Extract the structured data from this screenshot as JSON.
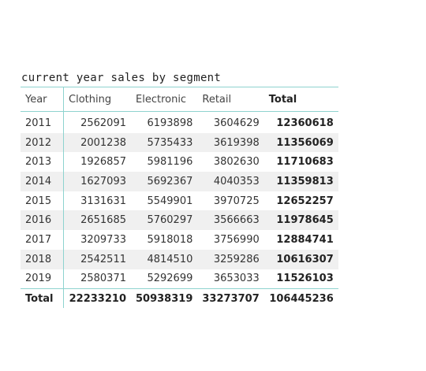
{
  "visual": {
    "title": "current year sales by segment",
    "columns": [
      "Year",
      "Clothing",
      "Electronic",
      "Retail",
      "Total"
    ],
    "rows": [
      {
        "year": "2011",
        "clothing": "2562091",
        "electronic": "6193898",
        "retail": "3604629",
        "total": "12360618"
      },
      {
        "year": "2012",
        "clothing": "2001238",
        "electronic": "5735433",
        "retail": "3619398",
        "total": "11356069"
      },
      {
        "year": "2013",
        "clothing": "1926857",
        "electronic": "5981196",
        "retail": "3802630",
        "total": "11710683"
      },
      {
        "year": "2014",
        "clothing": "1627093",
        "electronic": "5692367",
        "retail": "4040353",
        "total": "11359813"
      },
      {
        "year": "2015",
        "clothing": "3131631",
        "electronic": "5549901",
        "retail": "3970725",
        "total": "12652257"
      },
      {
        "year": "2016",
        "clothing": "2651685",
        "electronic": "5760297",
        "retail": "3566663",
        "total": "11978645"
      },
      {
        "year": "2017",
        "clothing": "3209733",
        "electronic": "5918018",
        "retail": "3756990",
        "total": "12884741"
      },
      {
        "year": "2018",
        "clothing": "2542511",
        "electronic": "4814510",
        "retail": "3259286",
        "total": "10616307"
      },
      {
        "year": "2019",
        "clothing": "2580371",
        "electronic": "5292699",
        "retail": "3653033",
        "total": "11526103"
      }
    ],
    "grand_total": {
      "label": "Total",
      "clothing": "22233210",
      "electronic": "50938319",
      "retail": "33273707",
      "total": "106445236"
    },
    "colors": {
      "accent_border": "#8ed3cf",
      "stripe": "#f0f0f0"
    }
  }
}
